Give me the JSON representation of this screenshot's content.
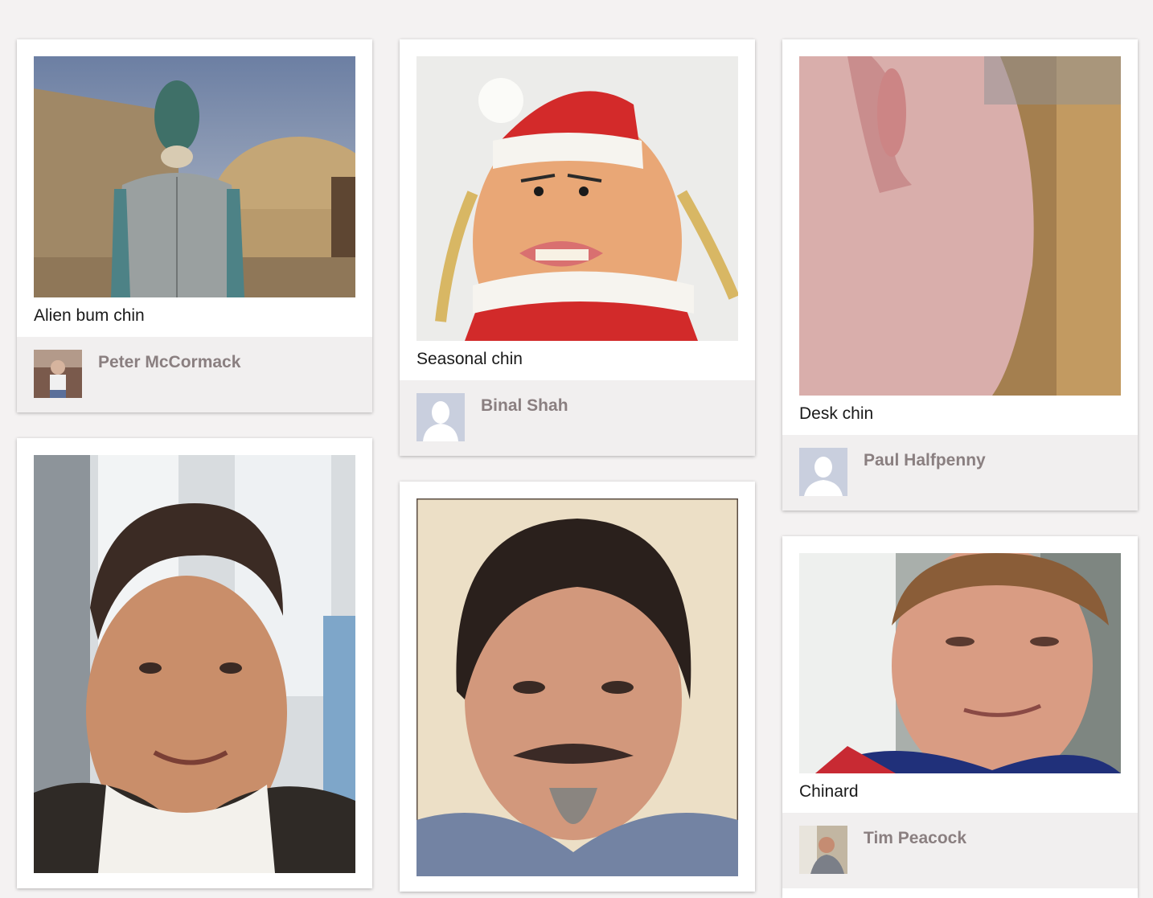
{
  "cards": [
    {
      "caption": "Alien bum chin",
      "user": "Peter McCormack",
      "image": "alien-bum-chin-photo",
      "avatar": "user-photo-avatar"
    },
    {
      "caption": "Seasonal chin",
      "user": "Binal Shah",
      "image": "santa-hat-puppet-photo",
      "avatar": "default-female-avatar"
    },
    {
      "caption": "Desk chin",
      "user": "Paul Halfpenny",
      "image": "desk-chin-closeup-photo",
      "avatar": "default-male-avatar"
    },
    {
      "caption": "",
      "user": "",
      "image": "man-big-chin-selfie-photo",
      "avatar": ""
    },
    {
      "caption": "",
      "user": "",
      "image": "bearded-man-portrait-photo",
      "avatar": ""
    },
    {
      "caption": "Chinard",
      "user": "Tim Peacock",
      "image": "footballer-portrait-photo",
      "avatar": "user-photo-avatar"
    }
  ],
  "colors": {
    "background": "#f4f2f2",
    "card": "#ffffff",
    "card_footer": "#f1efef",
    "username": "#8a7f80",
    "caption": "#1a1a1a"
  }
}
